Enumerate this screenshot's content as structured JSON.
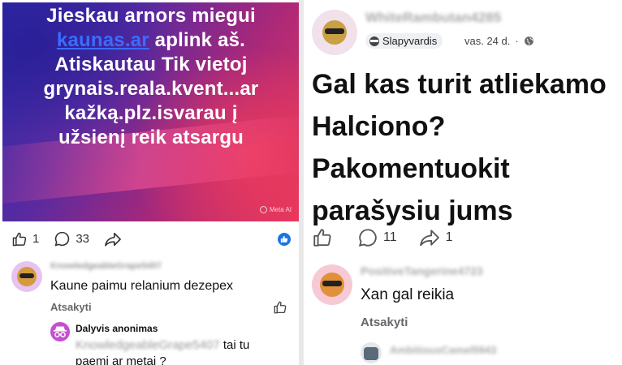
{
  "left_post": {
    "image_text": {
      "line1": "Jieskau arnors miegui",
      "link": "kaunas.ar",
      "line2_rest": " aplink aš.",
      "line3": "Atiskautau Tik vietoj",
      "line4": "grynais.reala.kvent...ar",
      "line5": "kažką.plz.isvarau į",
      "line6": "užsienį reik atsargu"
    },
    "watermark": "Meta AI",
    "like_count": "1",
    "comment_count": "33"
  },
  "left_comments": [
    {
      "username": "KnowledgeableGrape5407",
      "text": "Kaune paimu relanium dezepex",
      "reply_label": "Atsakyti"
    }
  ],
  "left_reply": {
    "author": "Dalyvis anonimas",
    "mention": "KnowledgeableGrape5407",
    "text_after_mention": " tai tu",
    "text_line2": "paemi ar metai ?"
  },
  "right_post": {
    "username": "WhiteRambutan4285",
    "badge_label": "Slapyvardis",
    "date": "vas. 24 d.",
    "separator": "·",
    "headline_lines": [
      "Gal kas turit atliekamo",
      "Halciono?",
      "Pakomentuokit",
      "parašysiu jums"
    ],
    "comment_count": "11",
    "share_count": "1"
  },
  "right_comments": [
    {
      "username": "PositiveTangerine4723",
      "text": "Xan gal reikia",
      "reply_label": "Atsakyti"
    },
    {
      "username": "AmbitiousCamel5943"
    }
  ],
  "colors": {
    "link_blue": "#3b6cff",
    "like_blue": "#1b74e4",
    "meta_gray": "#65676b",
    "avatar_purple": "#e7c3ef",
    "avatar_pink": "#f7c9d5",
    "anon_avatar": "#c64fd2"
  },
  "icons": [
    "thumb-up-icon",
    "comment-bubble-icon",
    "share-arrow-icon",
    "like-badge-icon",
    "incognito-icon",
    "globe-icon",
    "sunglasses-emoji-icon"
  ]
}
